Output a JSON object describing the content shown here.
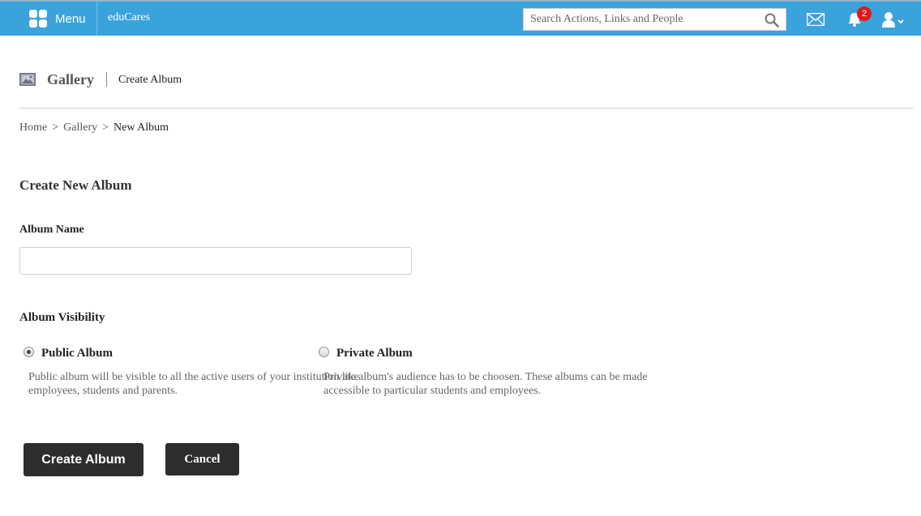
{
  "topbar": {
    "menu_label": "Menu",
    "brand": "eduCares",
    "search_placeholder": "Search Actions, Links and People",
    "notification_count": "2",
    "accent_color": "#3ba3dc",
    "badge_color": "#e0181c",
    "icons": [
      "menu-grid-icon",
      "search-icon",
      "mail-icon",
      "bell-icon",
      "user-icon"
    ]
  },
  "header": {
    "title": "Gallery",
    "subtitle": "Create Album",
    "icon": "gallery-icon"
  },
  "breadcrumb": {
    "items": [
      "Home",
      "Gallery"
    ],
    "separator": ">",
    "current": "New Album"
  },
  "form": {
    "section_title": "Create New Album",
    "album_name_label": "Album Name",
    "album_name_value": "",
    "visibility_label": "Album Visibility",
    "options": [
      {
        "title": "Public Album",
        "description": "Public album will be visible to all the active users of your institution like employees, students and parents.",
        "checked": true
      },
      {
        "title": "Private Album",
        "description": "Private album's audience has to be choosen. These albums can be made accessible to particular students and employees.",
        "checked": false
      }
    ],
    "create_button": "Create Album",
    "cancel_button": "Cancel"
  }
}
